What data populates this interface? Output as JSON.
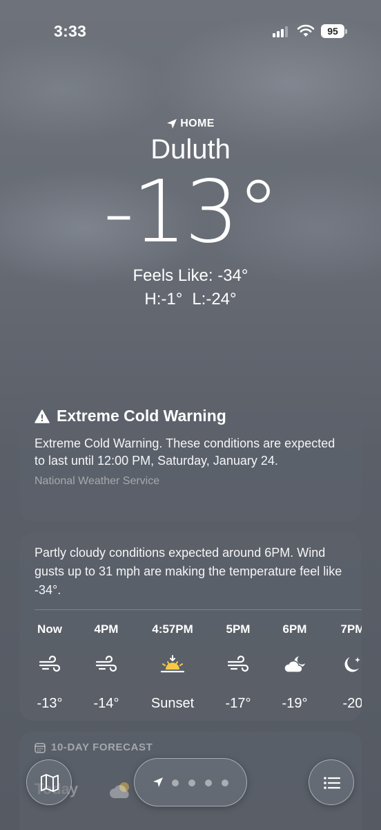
{
  "status_bar": {
    "time": "3:33",
    "battery": "95"
  },
  "location": {
    "label": "HOME",
    "city": "Duluth",
    "temperature": "-13°",
    "feels_like": "Feels Like: -34°",
    "high": "H:-1°",
    "low": "L:-24°"
  },
  "alert": {
    "title": "Extreme Cold Warning",
    "body": "Extreme Cold Warning. These conditions are expected to last until 12:00 PM, Saturday, January 24.",
    "source": "National Weather Service"
  },
  "hourly": {
    "summary": "Partly cloudy conditions expected around 6PM. Wind gusts up to 31 mph are making the temperature feel like -34°.",
    "items": [
      {
        "label": "Now",
        "icon": "wind-icon",
        "temp": "-13°"
      },
      {
        "label": "4PM",
        "icon": "wind-icon",
        "temp": "-14°"
      },
      {
        "label": "4:57PM",
        "icon": "sunset-icon",
        "temp": "Sunset"
      },
      {
        "label": "5PM",
        "icon": "wind-icon",
        "temp": "-17°"
      },
      {
        "label": "6PM",
        "icon": "partly-cloudy-night-icon",
        "temp": "-19°"
      },
      {
        "label": "7PM",
        "icon": "moon-stars-icon",
        "temp": "-20"
      }
    ]
  },
  "forecast": {
    "title": "10-DAY FORECAST",
    "first_day": "Today"
  },
  "colors": {
    "sun": "#f6c945",
    "background": "#60656e"
  }
}
